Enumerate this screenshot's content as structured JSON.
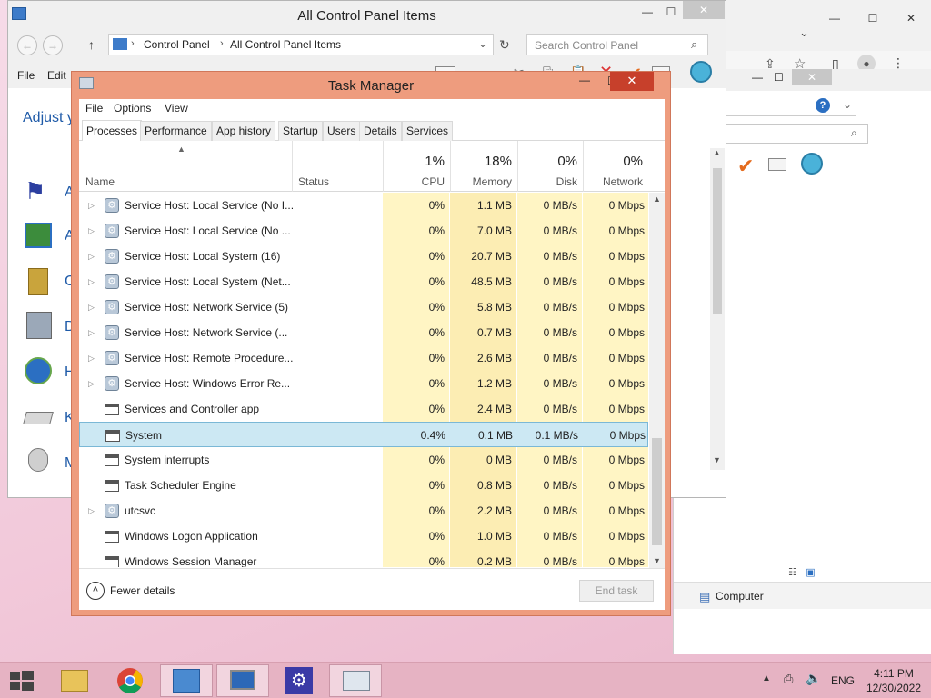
{
  "control_panel": {
    "title": "All Control Panel Items",
    "breadcrumb": [
      "Control Panel",
      "All Control Panel Items"
    ],
    "search_placeholder": "Search Control Panel",
    "menu": [
      "File",
      "Edit"
    ],
    "heading_partial": "Adjust y",
    "item_letters": [
      "A",
      "A",
      "C",
      "D",
      "H",
      "K",
      "M"
    ]
  },
  "background_window": {
    "status_item": "Computer"
  },
  "task_manager": {
    "title": "Task Manager",
    "menu": [
      "File",
      "Options",
      "View"
    ],
    "tabs": [
      "Processes",
      "Performance",
      "App history",
      "Startup",
      "Users",
      "Details",
      "Services"
    ],
    "active_tab": "Processes",
    "columns": {
      "name": "Name",
      "status": "Status",
      "cpu": {
        "pct": "1%",
        "label": "CPU"
      },
      "memory": {
        "pct": "18%",
        "label": "Memory"
      },
      "disk": {
        "pct": "0%",
        "label": "Disk"
      },
      "network": {
        "pct": "0%",
        "label": "Network"
      }
    },
    "rows": [
      {
        "name": "Service Host: Local Service (No I...",
        "expandable": true,
        "icon": "gear-icon",
        "cpu": "0%",
        "mem": "1.1 MB",
        "disk": "0 MB/s",
        "net": "0 Mbps"
      },
      {
        "name": "Service Host: Local Service (No ...",
        "expandable": true,
        "icon": "gear-icon",
        "cpu": "0%",
        "mem": "7.0 MB",
        "disk": "0 MB/s",
        "net": "0 Mbps"
      },
      {
        "name": "Service Host: Local System (16)",
        "expandable": true,
        "icon": "gear-icon",
        "cpu": "0%",
        "mem": "20.7 MB",
        "disk": "0 MB/s",
        "net": "0 Mbps"
      },
      {
        "name": "Service Host: Local System (Net...",
        "expandable": true,
        "icon": "gear-icon",
        "cpu": "0%",
        "mem": "48.5 MB",
        "disk": "0 MB/s",
        "net": "0 Mbps"
      },
      {
        "name": "Service Host: Network Service (5)",
        "expandable": true,
        "icon": "gear-icon",
        "cpu": "0%",
        "mem": "5.8 MB",
        "disk": "0 MB/s",
        "net": "0 Mbps"
      },
      {
        "name": "Service Host: Network Service (...",
        "expandable": true,
        "icon": "gear-icon",
        "cpu": "0%",
        "mem": "0.7 MB",
        "disk": "0 MB/s",
        "net": "0 Mbps"
      },
      {
        "name": "Service Host: Remote Procedure...",
        "expandable": true,
        "icon": "gear-icon",
        "cpu": "0%",
        "mem": "2.6 MB",
        "disk": "0 MB/s",
        "net": "0 Mbps"
      },
      {
        "name": "Service Host: Windows Error Re...",
        "expandable": true,
        "icon": "gear-icon",
        "cpu": "0%",
        "mem": "1.2 MB",
        "disk": "0 MB/s",
        "net": "0 Mbps"
      },
      {
        "name": "Services and Controller app",
        "expandable": false,
        "icon": "window-icon",
        "cpu": "0%",
        "mem": "2.4 MB",
        "disk": "0 MB/s",
        "net": "0 Mbps"
      },
      {
        "name": "System",
        "expandable": false,
        "icon": "window-icon",
        "cpu": "0.4%",
        "mem": "0.1 MB",
        "disk": "0.1 MB/s",
        "net": "0 Mbps",
        "selected": true
      },
      {
        "name": "System interrupts",
        "expandable": false,
        "icon": "window-icon",
        "cpu": "0%",
        "mem": "0 MB",
        "disk": "0 MB/s",
        "net": "0 Mbps"
      },
      {
        "name": "Task Scheduler Engine",
        "expandable": false,
        "icon": "window-icon",
        "cpu": "0%",
        "mem": "0.8 MB",
        "disk": "0 MB/s",
        "net": "0 Mbps"
      },
      {
        "name": "utcsvc",
        "expandable": true,
        "icon": "gear-icon",
        "cpu": "0%",
        "mem": "2.2 MB",
        "disk": "0 MB/s",
        "net": "0 Mbps"
      },
      {
        "name": "Windows Logon Application",
        "expandable": false,
        "icon": "window-icon",
        "cpu": "0%",
        "mem": "1.0 MB",
        "disk": "0 MB/s",
        "net": "0 Mbps"
      },
      {
        "name": "Windows Session Manager",
        "expandable": false,
        "icon": "window-icon",
        "cpu": "0%",
        "mem": "0.2 MB",
        "disk": "0 MB/s",
        "net": "0 Mbps"
      }
    ],
    "fewer_details": "Fewer details",
    "end_task": "End task"
  },
  "taskbar": {
    "apps": [
      "file-explorer-icon",
      "chrome-icon",
      "control-panel-icon",
      "remote-desktop-icon",
      "settings-gear-icon",
      "task-manager-icon"
    ],
    "language": "ENG",
    "time": "4:11 PM",
    "date": "12/30/2022"
  },
  "colors": {
    "task_manager_frame": "#ee9c7e",
    "close_button": "#c7402b",
    "selected_row": "#cce8f3",
    "heat_cell": "#fff5c4",
    "taskbar": "#e6b3c3"
  }
}
